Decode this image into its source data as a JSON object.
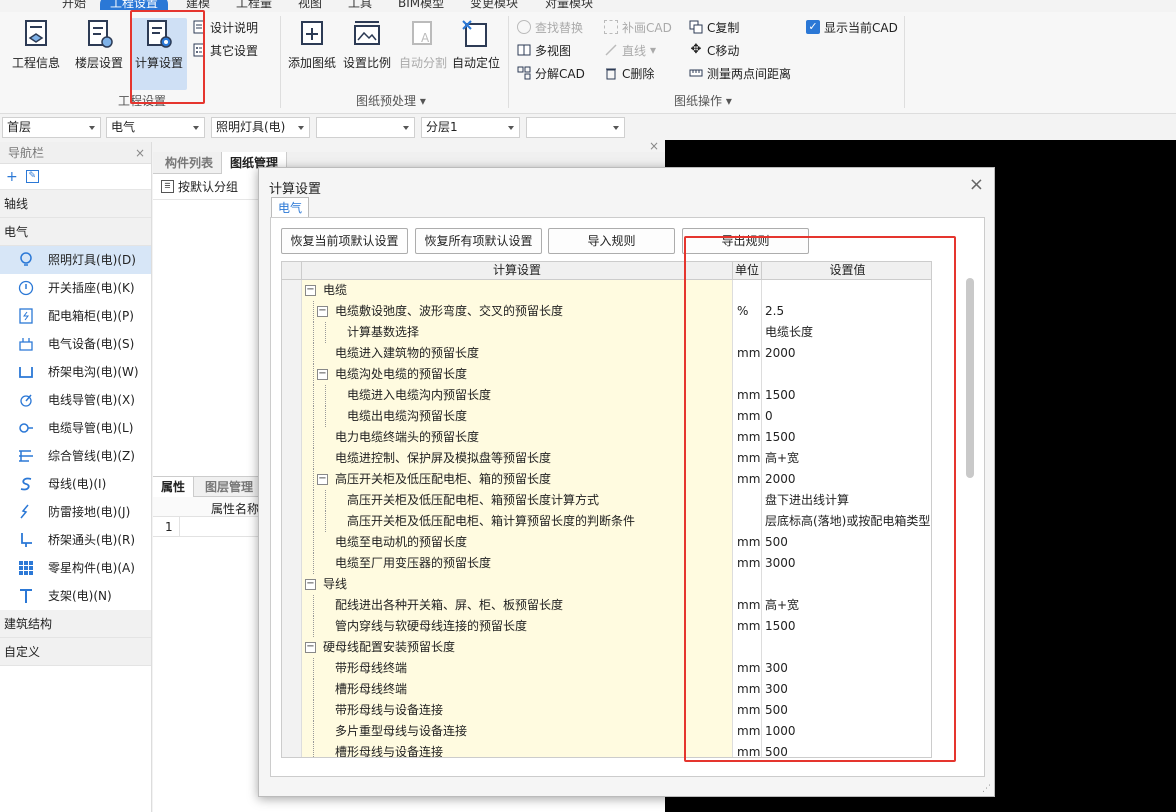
{
  "menubar": {
    "items": [
      "开始",
      "工程设置",
      "建模",
      "工程量",
      "视图",
      "工具",
      "BIM模型",
      "变更模块",
      "对量模块"
    ],
    "active_index": 1
  },
  "ribbon": {
    "group1": {
      "label": "工程设置",
      "buttons": [
        "工程信息",
        "楼层设置",
        "计算设置"
      ],
      "small": [
        "设计说明",
        "其它设置"
      ]
    },
    "group2": {
      "label": "图纸预处理",
      "buttons": [
        "添加图纸",
        "设置比例",
        "自动分割",
        "自动定位"
      ]
    },
    "group3": {
      "label": "图纸操作",
      "col1": [
        "查找替换",
        "多视图",
        "分解CAD"
      ],
      "col2": [
        "补画CAD",
        "直线",
        "C删除"
      ],
      "col3": [
        "C复制",
        "C移动",
        "测量两点间距离"
      ],
      "checkbox": "显示当前CAD"
    }
  },
  "filters": [
    "首层",
    "电气",
    "照明灯具(电)",
    "",
    "分层1",
    ""
  ],
  "nav": {
    "title": "导航栏",
    "sections": {
      "axis": "轴线",
      "elec": "电气",
      "struct": "建筑结构",
      "custom": "自定义"
    },
    "items": [
      "照明灯具(电)(D)",
      "开关插座(电)(K)",
      "配电箱柜(电)(P)",
      "电气设备(电)(S)",
      "桥架电沟(电)(W)",
      "电线导管(电)(X)",
      "电缆导管(电)(L)",
      "综合管线(电)(Z)",
      "母线(电)(I)",
      "防雷接地(电)(J)",
      "桥架通头(电)(R)",
      "零星构件(电)(A)",
      "支架(电)(N)"
    ]
  },
  "midpanel": {
    "tabs": [
      "构件列表",
      "图纸管理"
    ],
    "group_btn": "按默认分组"
  },
  "props": {
    "tabs": [
      "属性",
      "图层管理"
    ],
    "col_header": "属性名称",
    "row_num": "1"
  },
  "dialog": {
    "title": "计算设置",
    "tab": "电气",
    "buttons": [
      "恢复当前项默认设置",
      "恢复所有项默认设置",
      "导入规则",
      "导出规则"
    ],
    "headers": {
      "name": "计算设置",
      "unit": "单位",
      "value": "设置值"
    },
    "rows": [
      {
        "level": 0,
        "toggle": true,
        "name": "电缆",
        "unit": "",
        "value": ""
      },
      {
        "level": 1,
        "toggle": true,
        "name": "电缆敷设弛度、波形弯度、交叉的预留长度",
        "unit": "%",
        "value": "2.5"
      },
      {
        "level": 2,
        "toggle": false,
        "name": "计算基数选择",
        "unit": "",
        "value": "电缆长度"
      },
      {
        "level": 1,
        "toggle": false,
        "name": "电缆进入建筑物的预留长度",
        "unit": "mm",
        "value": "2000"
      },
      {
        "level": 1,
        "toggle": true,
        "name": "电缆沟处电缆的预留长度",
        "unit": "",
        "value": ""
      },
      {
        "level": 2,
        "toggle": false,
        "name": "电缆进入电缆沟内预留长度",
        "unit": "mm",
        "value": "1500"
      },
      {
        "level": 2,
        "toggle": false,
        "name": "电缆出电缆沟预留长度",
        "unit": "mm",
        "value": "0"
      },
      {
        "level": 1,
        "toggle": false,
        "name": "电力电缆终端头的预留长度",
        "unit": "mm",
        "value": "1500"
      },
      {
        "level": 1,
        "toggle": false,
        "name": "电缆进控制、保护屏及模拟盘等预留长度",
        "unit": "mm",
        "value": "高+宽"
      },
      {
        "level": 1,
        "toggle": true,
        "name": "高压开关柜及低压配电柜、箱的预留长度",
        "unit": "mm",
        "value": "2000"
      },
      {
        "level": 2,
        "toggle": false,
        "name": "高压开关柜及低压配电柜、箱预留长度计算方式",
        "unit": "",
        "value": "盘下进出线计算"
      },
      {
        "level": 2,
        "toggle": false,
        "name": "高压开关柜及低压配电柜、箱计算预留长度的判断条件",
        "unit": "",
        "value": "层底标高(落地)或按配电箱类型"
      },
      {
        "level": 1,
        "toggle": false,
        "name": "电缆至电动机的预留长度",
        "unit": "mm",
        "value": "500"
      },
      {
        "level": 1,
        "toggle": false,
        "name": "电缆至厂用变压器的预留长度",
        "unit": "mm",
        "value": "3000"
      },
      {
        "level": 0,
        "toggle": true,
        "name": "导线",
        "unit": "",
        "value": ""
      },
      {
        "level": 1,
        "toggle": false,
        "name": "配线进出各种开关箱、屏、柜、板预留长度",
        "unit": "mm",
        "value": "高+宽"
      },
      {
        "level": 1,
        "toggle": false,
        "name": "管内穿线与软硬母线连接的预留长度",
        "unit": "mm",
        "value": "1500"
      },
      {
        "level": 0,
        "toggle": true,
        "name": "硬母线配置安装预留长度",
        "unit": "",
        "value": ""
      },
      {
        "level": 1,
        "toggle": false,
        "name": "带形母线终端",
        "unit": "mm",
        "value": "300"
      },
      {
        "level": 1,
        "toggle": false,
        "name": "槽形母线终端",
        "unit": "mm",
        "value": "300"
      },
      {
        "level": 1,
        "toggle": false,
        "name": "带形母线与设备连接",
        "unit": "mm",
        "value": "500"
      },
      {
        "level": 1,
        "toggle": false,
        "name": "多片重型母线与设备连接",
        "unit": "mm",
        "value": "1000"
      },
      {
        "level": 1,
        "toggle": false,
        "name": "槽形母线与设备连接",
        "unit": "mm",
        "value": "500"
      }
    ]
  },
  "colors": {
    "accent": "#2b78d6",
    "highlight": "#e5352e",
    "row_bg": "#fffbe0"
  }
}
